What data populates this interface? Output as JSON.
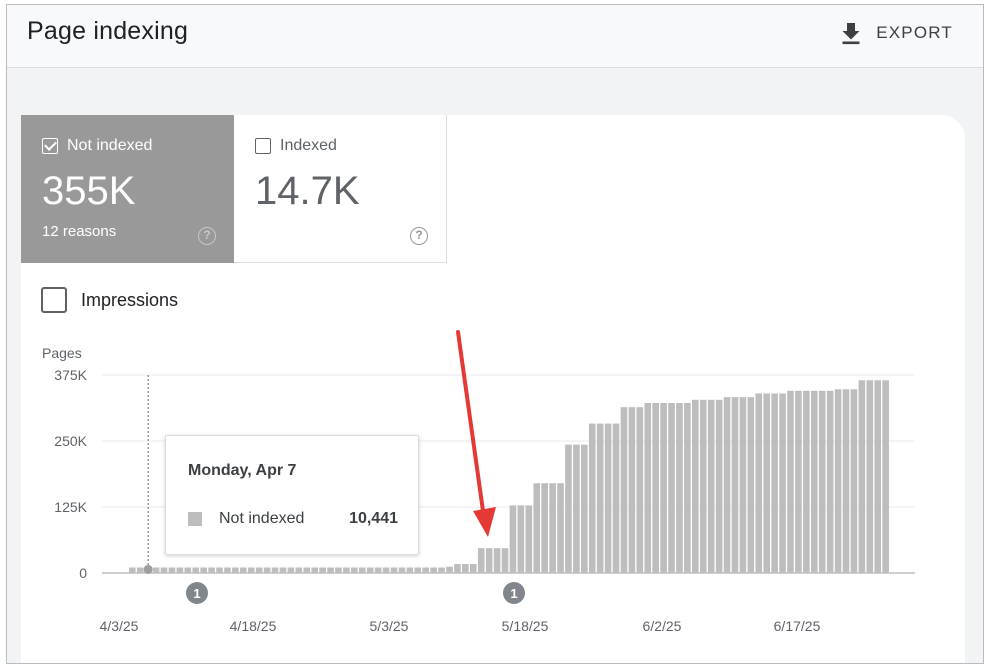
{
  "header": {
    "title": "Page indexing",
    "export_label": "EXPORT",
    "export_icon": "download-icon"
  },
  "metrics": {
    "not_indexed": {
      "label": "Not indexed",
      "value": "355K",
      "sub": "12 reasons",
      "checked": true,
      "color": "#999999"
    },
    "indexed": {
      "label": "Indexed",
      "value": "14.7K",
      "checked": false
    }
  },
  "impressions": {
    "label": "Impressions",
    "checked": false
  },
  "tooltip": {
    "date": "Monday, Apr 7",
    "series": "Not indexed",
    "value": "10,441"
  },
  "chart_data": {
    "type": "bar",
    "ylabel": "Pages",
    "yticks": [
      "0",
      "125K",
      "250K",
      "375K"
    ],
    "ylim": [
      0,
      375000
    ],
    "xtick_labels": [
      "4/3/25",
      "4/18/25",
      "5/3/25",
      "5/18/25",
      "6/2/25",
      "6/17/25"
    ],
    "annotations": [
      {
        "label": "1",
        "date": "4/8/25"
      },
      {
        "label": "1",
        "date": "5/17/25"
      }
    ],
    "series": [
      {
        "name": "Not indexed",
        "color": "#bdbdbd",
        "values": [
          10400,
          10400,
          10441,
          10400,
          10400,
          10400,
          10400,
          10400,
          10400,
          10400,
          10400,
          10400,
          10400,
          10400,
          10400,
          10400,
          10400,
          10400,
          10400,
          10400,
          10400,
          10400,
          10400,
          10400,
          10400,
          10400,
          10400,
          10400,
          10400,
          10400,
          10400,
          10400,
          10400,
          10400,
          10400,
          10400,
          10400,
          10400,
          10400,
          10400,
          12000,
          17000,
          17000,
          17000,
          47000,
          47000,
          47000,
          47000,
          128000,
          128000,
          128000,
          170000,
          170000,
          170000,
          170000,
          243000,
          243000,
          243000,
          283000,
          283000,
          283000,
          283000,
          314000,
          314000,
          314000,
          322000,
          322000,
          322000,
          322000,
          322000,
          322000,
          328000,
          328000,
          328000,
          328000,
          333000,
          333000,
          333000,
          333000,
          340000,
          340000,
          340000,
          340000,
          345000,
          345000,
          345000,
          345000,
          345000,
          345000,
          348000,
          348000,
          348000,
          365000,
          365000,
          365000,
          365000
        ]
      }
    ]
  }
}
